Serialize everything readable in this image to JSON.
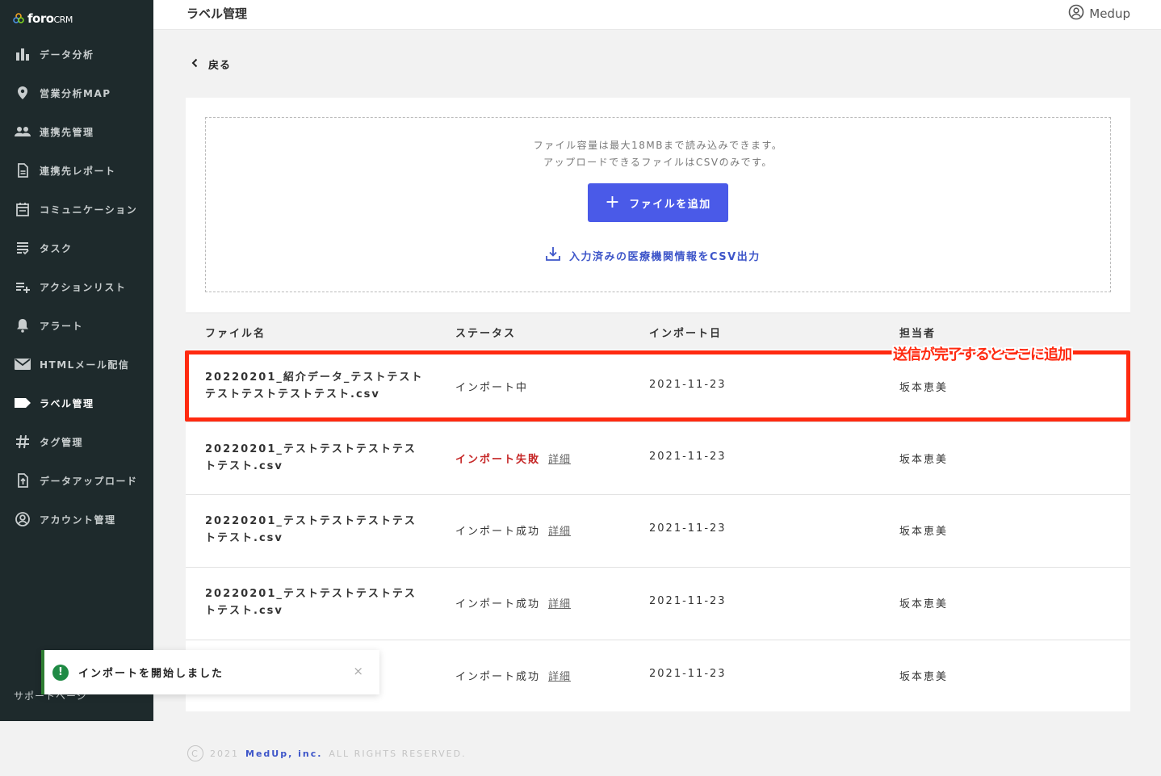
{
  "brand": {
    "logo_main": "foro",
    "logo_sub": "CRM"
  },
  "sidebar": {
    "items": [
      {
        "label": "データ分析",
        "icon": "bar-chart-icon"
      },
      {
        "label": "営業分析MAP",
        "icon": "map-pin-icon"
      },
      {
        "label": "連携先管理",
        "icon": "people-icon"
      },
      {
        "label": "連携先レポート",
        "icon": "document-icon"
      },
      {
        "label": "コミュニケーション",
        "icon": "calendar-icon"
      },
      {
        "label": "タスク",
        "icon": "task-list-icon"
      },
      {
        "label": "アクションリスト",
        "icon": "playlist-add-icon"
      },
      {
        "label": "アラート",
        "icon": "bell-icon"
      },
      {
        "label": "HTMLメール配信",
        "icon": "mail-icon"
      },
      {
        "label": "ラベル管理",
        "icon": "label-icon"
      },
      {
        "label": "タグ管理",
        "icon": "hash-icon"
      },
      {
        "label": "データアップロード",
        "icon": "upload-file-icon"
      },
      {
        "label": "アカウント管理",
        "icon": "account-circle-icon"
      }
    ],
    "active_index": 9,
    "support": "サポートページ"
  },
  "header": {
    "title": "ラベル管理",
    "user": "Medup"
  },
  "back": {
    "label": "戻る"
  },
  "upload": {
    "line1": "ファイル容量は最大18MBまで読み込みできます。",
    "line2": "アップロードできるファイルはCSVのみです。",
    "add_button": "ファイルを追加",
    "export_link": "入力済みの医療機関情報をCSV出力"
  },
  "table": {
    "headers": {
      "filename": "ファイル名",
      "status": "ステータス",
      "import_date": "インポート日",
      "owner": "担当者"
    },
    "rows": [
      {
        "filename": "20220201_紹介データ_テストテストテストテストテストテスト.csv",
        "status": "インポート中",
        "detail": "",
        "date": "2021-11-23",
        "owner": "坂本恵美"
      },
      {
        "filename": "20220201_テストテストテストテストテスト.csv",
        "status": "インポート失敗",
        "detail": "詳細",
        "date": "2021-11-23",
        "owner": "坂本恵美"
      },
      {
        "filename": "20220201_テストテストテストテストテスト.csv",
        "status": "インポート成功",
        "detail": "詳細",
        "date": "2021-11-23",
        "owner": "坂本恵美"
      },
      {
        "filename": "20220201_テストテストテストテストテスト.csv",
        "status": "インポート成功",
        "detail": "詳細",
        "date": "2021-11-23",
        "owner": "坂本恵美"
      },
      {
        "filename": "",
        "status": "インポート成功",
        "detail": "詳細",
        "date": "2021-11-23",
        "owner": "坂本恵美"
      }
    ]
  },
  "annotation": {
    "text": "送信が完了するとここに追加",
    "color": "#ff2a10"
  },
  "toast": {
    "message": "インポートを開始しました",
    "close": "×"
  },
  "footer": {
    "year": "2021",
    "company": "MedUp, inc.",
    "rights": "ALL RIGHTS RESERVED."
  },
  "colors": {
    "sidebar_bg": "#1e2a2c",
    "accent": "#4a5ae8",
    "fail": "#c62828",
    "success_toast": "#1f8a44"
  }
}
